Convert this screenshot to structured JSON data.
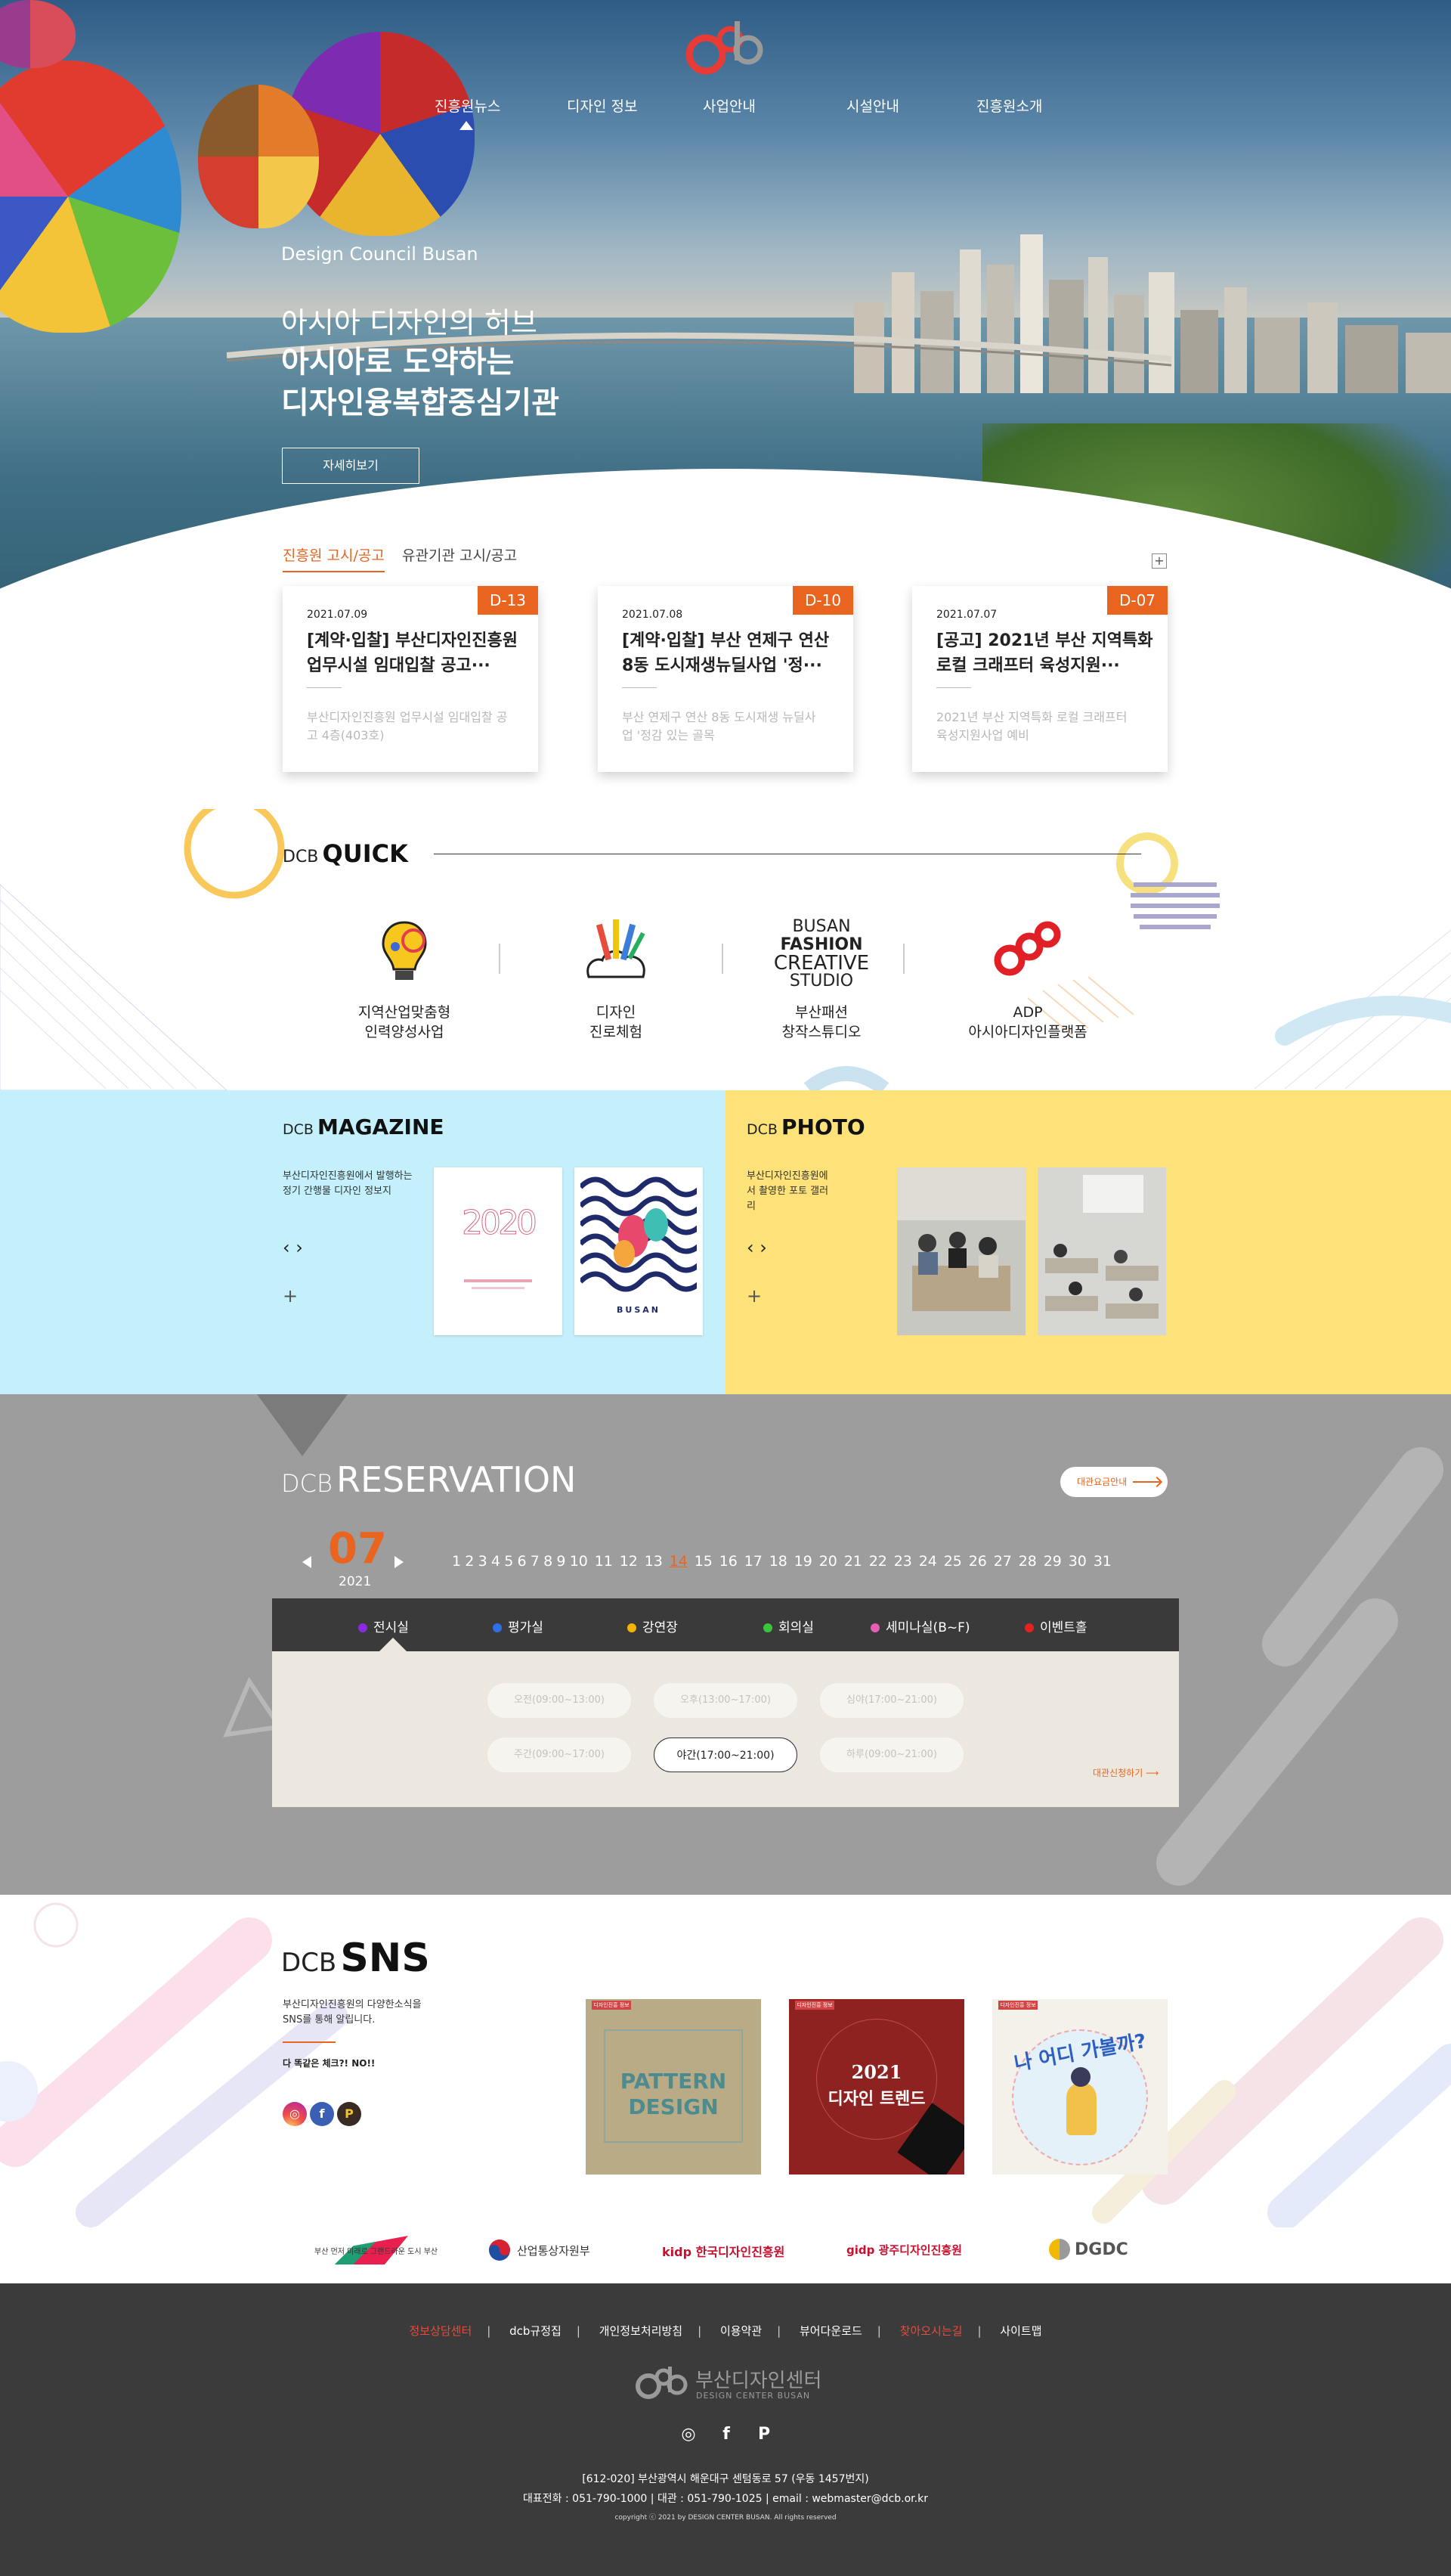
{
  "nav": {
    "items": [
      "진흥원뉴스",
      "디자인 정보",
      "사업안내",
      "시설안내",
      "진흥원소개"
    ]
  },
  "hero": {
    "subtitle": "Design Council Busan",
    "line1": "아시아 디자인의 허브",
    "line2": "아시아로 도약하는",
    "line3": "디자인융복합중심기관",
    "button": "자세히보기"
  },
  "notice": {
    "tabs": [
      "진흥원 고시/공고",
      "유관기관 고시/공고"
    ],
    "more": "+",
    "cards": [
      {
        "dday": "D-13",
        "date": "2021.07.09",
        "title": "[계약·입찰] 부산디자인진흥원 업무시설 임대입찰 공고···",
        "desc": "부산디자인진흥원 업무시설 임대입찰 공고 4층(403호)"
      },
      {
        "dday": "D-10",
        "date": "2021.07.08",
        "title": "[계약·입찰] 부산 연제구 연산 8동 도시재생뉴딜사업 '정···",
        "desc": "부산 연제구 연산 8동 도시재생 뉴딜사업 '정감 있는 골목"
      },
      {
        "dday": "D-07",
        "date": "2021.07.07",
        "title": "[공고] 2021년 부산 지역특화 로컬 크래프터 육성지원···",
        "desc": "2021년 부산 지역특화 로컬 크래프터 육성지원사업 예비"
      }
    ]
  },
  "quick": {
    "small": "DCB",
    "big": "QUICK",
    "items": [
      {
        "label1": "지역산업맞춤형",
        "label2": "인력양성사업"
      },
      {
        "label1": "디자인",
        "label2": "진로체험"
      },
      {
        "label1": "부산패션",
        "label2": "창작스튜디오"
      },
      {
        "label1": "ADP",
        "label2": "아시아디자인플랫폼"
      }
    ],
    "busan_logo": {
      "l1": "BUSAN",
      "l2": "FASHION",
      "l3": "CREATIVE",
      "l4": "STUDIO"
    }
  },
  "magazine": {
    "small": "DCB",
    "big": "MAGAZINE",
    "desc": "부산디자인진흥원에서 발행하는 정기 간행물 디자인 정보지",
    "arrows": "‹ ›",
    "plus": "+",
    "thumb1_text": "2020",
    "thumb2_text": "BUSAN"
  },
  "photo": {
    "small": "DCB",
    "big": "PHOTO",
    "desc": "부산디자인진흥원에서 촬영한 포토 갤러리",
    "arrows": "‹ ›",
    "plus": "+"
  },
  "reservation": {
    "small": "DCB",
    "big": "RESERVATION",
    "guide": "대관요금안내",
    "month": "07",
    "year": "2021",
    "days": [
      "1",
      "2",
      "3",
      "4",
      "5",
      "6",
      "7",
      "8",
      "9",
      "10",
      "11",
      "12",
      "13",
      "14",
      "15",
      "16",
      "17",
      "18",
      "19",
      "20",
      "21",
      "22",
      "23",
      "24",
      "25",
      "26",
      "27",
      "28",
      "29",
      "30",
      "31"
    ],
    "today": "14",
    "rooms": [
      {
        "name": "전시실",
        "color": "#8a2be2"
      },
      {
        "name": "평가실",
        "color": "#2f6fe8"
      },
      {
        "name": "강연장",
        "color": "#f2b400"
      },
      {
        "name": "회의실",
        "color": "#3cc63c"
      },
      {
        "name": "세미나실(B~F)",
        "color": "#e65fb0"
      },
      {
        "name": "이벤트홀",
        "color": "#e52222"
      }
    ],
    "slots": [
      "오전(09:00~13:00)",
      "오후(13:00~17:00)",
      "심야(17:00~21:00)",
      "주간(09:00~17:00)",
      "야간(17:00~21:00)",
      "하루(09:00~21:00)"
    ],
    "active_slot": 4,
    "apply": "대관신청하기"
  },
  "sns": {
    "small": "DCB",
    "big": "SNS",
    "desc": "부산디자인진흥원의 다양한소식을 SNS를 통해 알립니다.",
    "question": "다 똑같은 체크?! NO!!",
    "icons": [
      "instagram-icon",
      "facebook-icon",
      "post-icon"
    ],
    "feeds": [
      {
        "tag": "디자인진흥 정보",
        "line1": "PATTERN",
        "line2": "DESIGN",
        "bg": "#b9ab86"
      },
      {
        "tag": "디자인진흥 정보",
        "line1": "2021",
        "line2": "디자인 트렌드",
        "bg": "#8e2220"
      },
      {
        "tag": "디자인진흥 정보",
        "line1": "나 어디 가볼까?",
        "line2": "",
        "bg": "#f4f1ea"
      }
    ]
  },
  "partners": [
    "부산 먼저 미래로 그랜드라운 도시 부산",
    "산업통상자원부",
    "kidp 한국디자인진흥원",
    "gidp 광주디자인진흥원",
    "DGDC"
  ],
  "footer": {
    "links": [
      "정보상담센터",
      "dcb규정집",
      "개인정보처리방침",
      "이용약관",
      "뷰어다운로드",
      "찾아오시는길",
      "사이트맵"
    ],
    "logo_kr": "부산디자인센터",
    "logo_en": "DESIGN CENTER BUSAN",
    "address": "[612-020] 부산광역시 해운대구 센텀동로 57 (우동 1457번지)",
    "phone": "대표전화 : 051-790-1000 | 대관 : 051-790-1025 | email : webmaster@dcb.or.kr",
    "copyright": "copyright ⓒ 2021 by DESIGN CENTER BUSAN. All rights reserved"
  }
}
